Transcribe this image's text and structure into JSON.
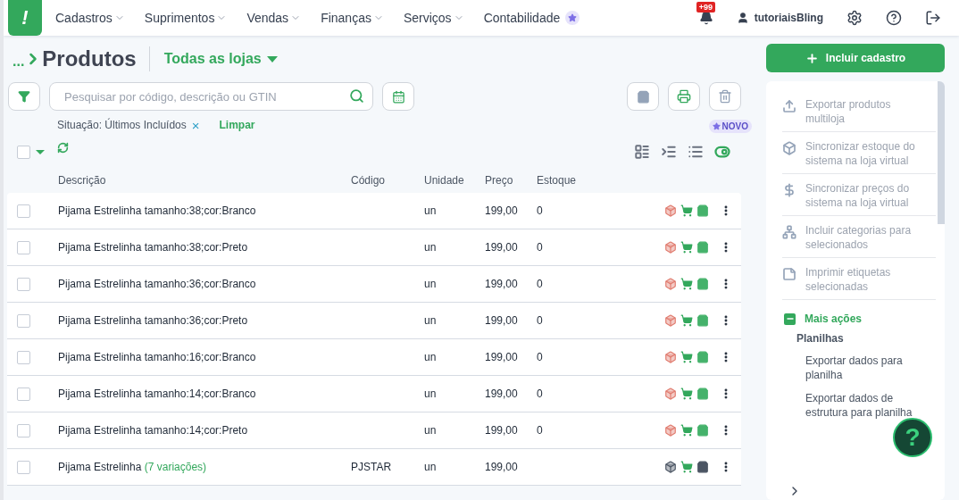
{
  "nav": {
    "logo": "!",
    "items": [
      {
        "label": "Cadastros",
        "dropdown": true
      },
      {
        "label": "Suprimentos",
        "dropdown": true
      },
      {
        "label": "Vendas",
        "dropdown": true
      },
      {
        "label": "Finanças",
        "dropdown": true
      },
      {
        "label": "Serviços",
        "dropdown": true
      },
      {
        "label": "Contabilidade",
        "dropdown": false
      }
    ],
    "notifications": "+99",
    "user": "tutoriaisBling"
  },
  "header": {
    "breadcrumb": "...",
    "title": "Produtos",
    "store_selector": "Todas as lojas"
  },
  "search": {
    "placeholder": "Pesquisar por código, descrição ou GTIN"
  },
  "filter": {
    "label": "Situação: Últimos Incluídos",
    "remove": "×",
    "clear": "Limpar"
  },
  "select_all": {
    "checked": false
  },
  "new_badge": "NOVO",
  "view_modes": [
    {
      "selected": false
    },
    {
      "selected": false
    },
    {
      "selected": false
    },
    {
      "selected": true
    }
  ],
  "table": {
    "columns": [
      "Descrição",
      "Código",
      "Unidade",
      "Preço",
      "Estoque"
    ],
    "rows": [
      {
        "description": "Pijama Estrelinha tamanho:38;cor:Branco",
        "code": "",
        "unit": "un",
        "price": "199,00",
        "stock": "0",
        "kind": "variation",
        "checked": false
      },
      {
        "description": "Pijama Estrelinha tamanho:38;cor:Preto",
        "code": "",
        "unit": "un",
        "price": "199,00",
        "stock": "0",
        "kind": "variation",
        "checked": false
      },
      {
        "description": "Pijama Estrelinha tamanho:36;cor:Branco",
        "code": "",
        "unit": "un",
        "price": "199,00",
        "stock": "0",
        "kind": "variation",
        "checked": false
      },
      {
        "description": "Pijama Estrelinha tamanho:36;cor:Preto",
        "code": "",
        "unit": "un",
        "price": "199,00",
        "stock": "0",
        "kind": "variation",
        "checked": false
      },
      {
        "description": "Pijama Estrelinha tamanho:16;cor:Branco",
        "code": "",
        "unit": "un",
        "price": "199,00",
        "stock": "0",
        "kind": "variation",
        "checked": false
      },
      {
        "description": "Pijama Estrelinha tamanho:14;cor:Branco",
        "code": "",
        "unit": "un",
        "price": "199,00",
        "stock": "0",
        "kind": "variation",
        "checked": false
      },
      {
        "description": "Pijama Estrelinha tamanho:14;cor:Preto",
        "code": "",
        "unit": "un",
        "price": "199,00",
        "stock": "0",
        "kind": "variation",
        "checked": false
      },
      {
        "description": "Pijama Estrelinha",
        "variations": "(7 variações)",
        "code": "PJSTAR",
        "unit": "un",
        "price": "199,00",
        "stock": "",
        "kind": "parent",
        "checked": false
      }
    ]
  },
  "sidebar": {
    "primary_button": "Incluir cadastro",
    "actions": [
      "Exportar produtos multiloja",
      "Sincronizar estoque do sistema na loja virtual",
      "Sincronizar preços do sistema na loja virtual",
      "Incluir categorias para selecionados",
      "Imprimir etiquetas selecionadas"
    ],
    "more": {
      "label": "Mais ações",
      "expanded": true,
      "group": "Planilhas",
      "items": [
        "Exportar dados para planilha",
        "Exportar dados de estrutura para planilha"
      ]
    }
  },
  "help_button": "?"
}
